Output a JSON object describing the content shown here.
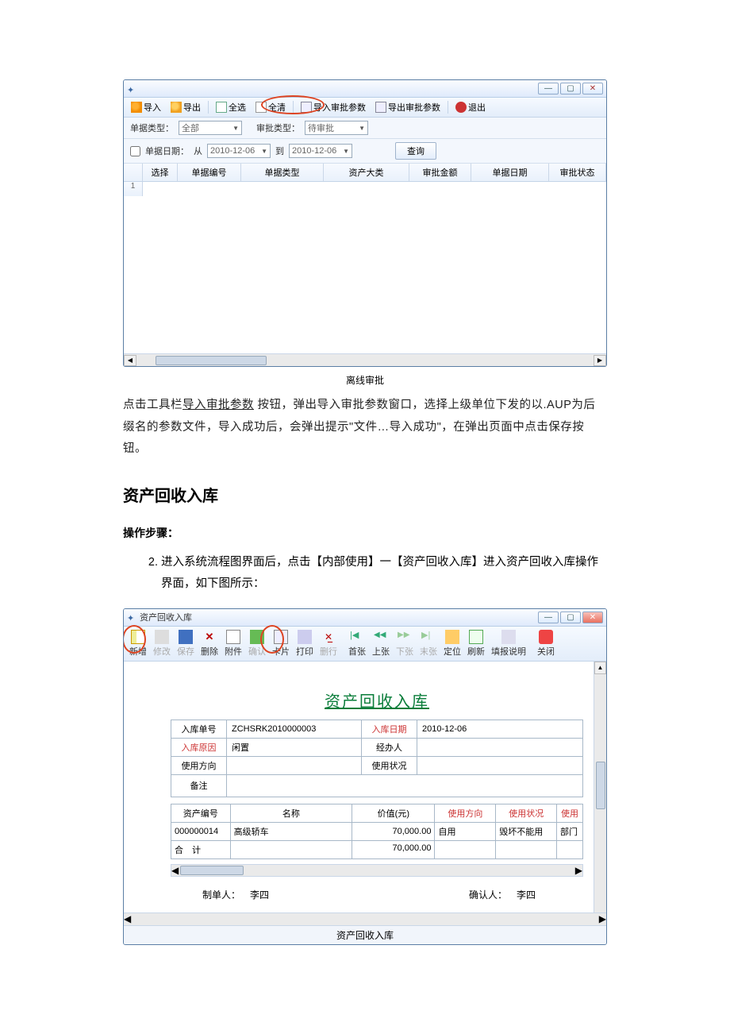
{
  "win1": {
    "toolbar": {
      "import": "导入",
      "export": "导出",
      "select_all": "全选",
      "clear_all": "全清",
      "import_params": "导入审批参数",
      "export_params": "导出审批参数",
      "exit": "退出"
    },
    "filters": {
      "doc_type_label": "单据类型：",
      "doc_type_value": "全部",
      "approve_type_label": "审批类型：",
      "approve_type_value": "待审批",
      "doc_date_label": "单据日期：",
      "from_label": "从",
      "from_value": "2010-12-06",
      "to_label": "到",
      "to_value": "2010-12-06",
      "query": "查询"
    },
    "columns": {
      "select": "选择",
      "doc_no": "单据编号",
      "doc_type": "单据类型",
      "asset_cat": "资产大类",
      "approve_amt": "审批金额",
      "doc_date": "单据日期",
      "approve_status": "审批状态"
    },
    "row1": "1",
    "caption": "离线审批"
  },
  "body": {
    "p1a": "点击工具栏",
    "p1b": "导入审批参数",
    "p1c": "按钮，弹出导入审批参数窗口，选择上级单位下发的以.AUP为后缀名的参数文件，导入成功后，会弹出提示\"文件…导入成功\"，在弹出页面中点击保存按 钮。",
    "h2": "资产回收入库",
    "h3": "操作步骤：",
    "step": "进入系统流程图界面后，点击【内部使用】一【资产回收入库】进入资产回收入库操作界面，如下图所示："
  },
  "win2": {
    "title": "资产回收入库",
    "tb": {
      "new": "新增",
      "mod": "修改",
      "save": "保存",
      "del": "删除",
      "att": "附件",
      "ok": "确认",
      "card": "卡片",
      "print": "打印",
      "delrow": "删行",
      "first": "首张",
      "prev": "上张",
      "next": "下张",
      "last": "末张",
      "locate": "定位",
      "refresh": "刷新",
      "help": "填报说明",
      "close": "关闭"
    },
    "form_title": "资产回收入库",
    "form": {
      "in_no_lbl": "入库单号",
      "in_no_val": "ZCHSRK2010000003",
      "in_date_lbl": "入库日期",
      "in_date_val": "2010-12-06",
      "reason_lbl": "入库原因",
      "reason_val": "闲置",
      "handler_lbl": "经办人",
      "direction_lbl": "使用方向",
      "status_lbl": "使用状况",
      "remark_lbl": "备注"
    },
    "grid": {
      "h_asset_no": "资产编号",
      "h_name": "名称",
      "h_value": "价值(元)",
      "h_direction": "使用方向",
      "h_status": "使用状况",
      "h_user": "使用",
      "r1_no": "000000014",
      "r1_name": "高级轿车",
      "r1_value": "70,000.00",
      "r1_dir": "自用",
      "r1_status": "毁坏不能用",
      "r1_user": "部门",
      "sum_lbl": "合　计",
      "sum_val": "70,000.00"
    },
    "sign": {
      "maker_lbl": "制单人：",
      "maker_val": "李四",
      "confirm_lbl": "确认人：",
      "confirm_val": "李四"
    },
    "status": "资产回收入库"
  }
}
